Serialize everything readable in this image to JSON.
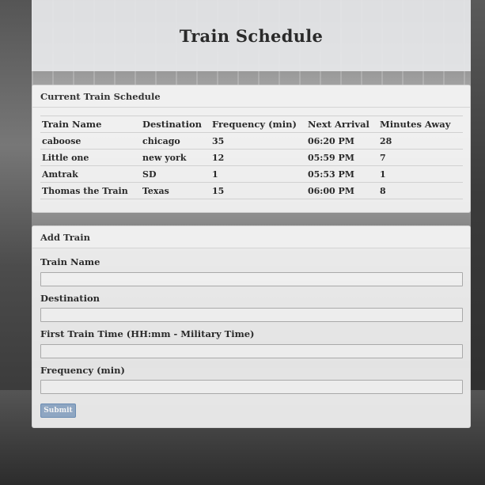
{
  "header": {
    "title": "Train Schedule"
  },
  "schedule": {
    "heading": "Current Train Schedule",
    "columns": [
      "Train Name",
      "Destination",
      "Frequency (min)",
      "Next Arrival",
      "Minutes Away"
    ],
    "rows": [
      [
        "caboose",
        "chicago",
        "35",
        "06:20 PM",
        "28"
      ],
      [
        "Little one",
        "new york",
        "12",
        "05:59 PM",
        "7"
      ],
      [
        "Amtrak",
        "SD",
        "1",
        "05:53 PM",
        "1"
      ],
      [
        "Thomas the Train",
        "Texas",
        "15",
        "06:00 PM",
        "8"
      ]
    ]
  },
  "add_train": {
    "heading": "Add Train",
    "fields": {
      "train_name": {
        "label": "Train Name",
        "value": ""
      },
      "destination": {
        "label": "Destination",
        "value": ""
      },
      "first_time": {
        "label": "First Train Time (HH:mm - Military Time)",
        "value": ""
      },
      "frequency": {
        "label": "Frequency (min)",
        "value": ""
      }
    },
    "submit_label": "Submit"
  }
}
